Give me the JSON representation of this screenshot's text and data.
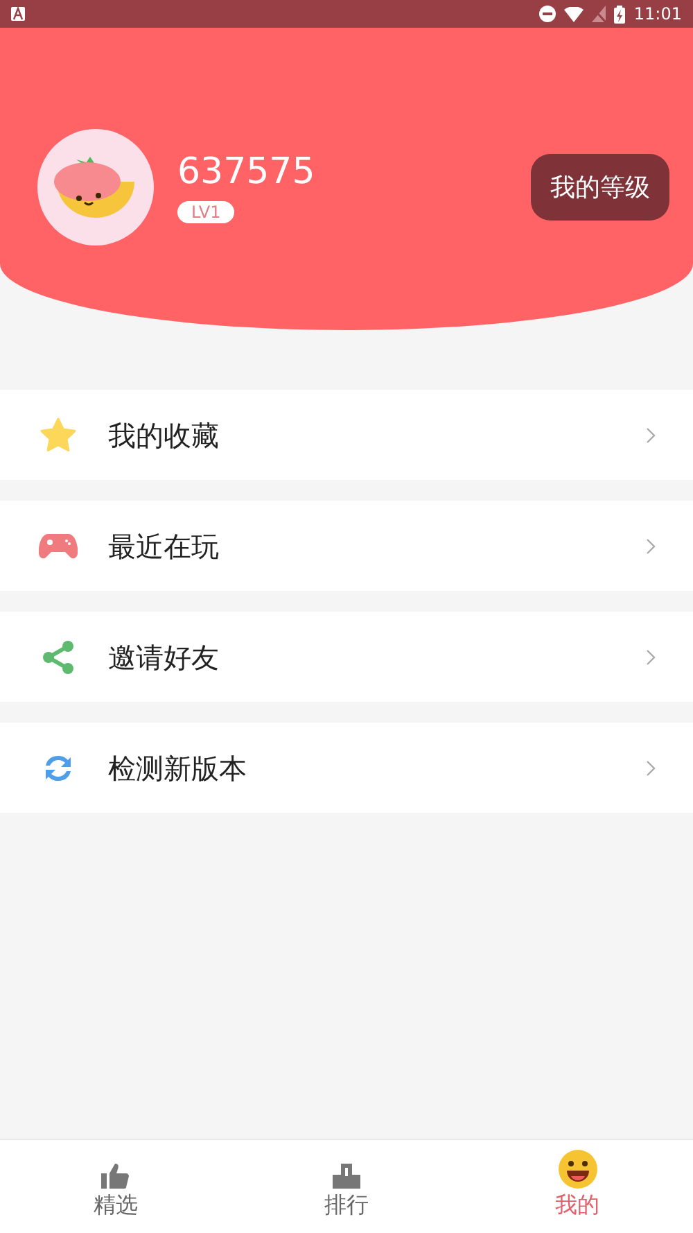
{
  "status_bar": {
    "time": "11:01"
  },
  "profile": {
    "username": "637575",
    "level_badge": "LV1",
    "level_button": "我的等级"
  },
  "menu": [
    {
      "kind": "star",
      "label": "我的收藏"
    },
    {
      "kind": "gamepad",
      "label": "最近在玩"
    },
    {
      "kind": "share",
      "label": "邀请好友"
    },
    {
      "kind": "refresh",
      "label": "检测新版本"
    }
  ],
  "tabs": [
    {
      "kind": "thumb",
      "label": "精选",
      "selected": false
    },
    {
      "kind": "podium",
      "label": "排行",
      "selected": false
    },
    {
      "kind": "smiley",
      "label": "我的",
      "selected": true
    }
  ]
}
